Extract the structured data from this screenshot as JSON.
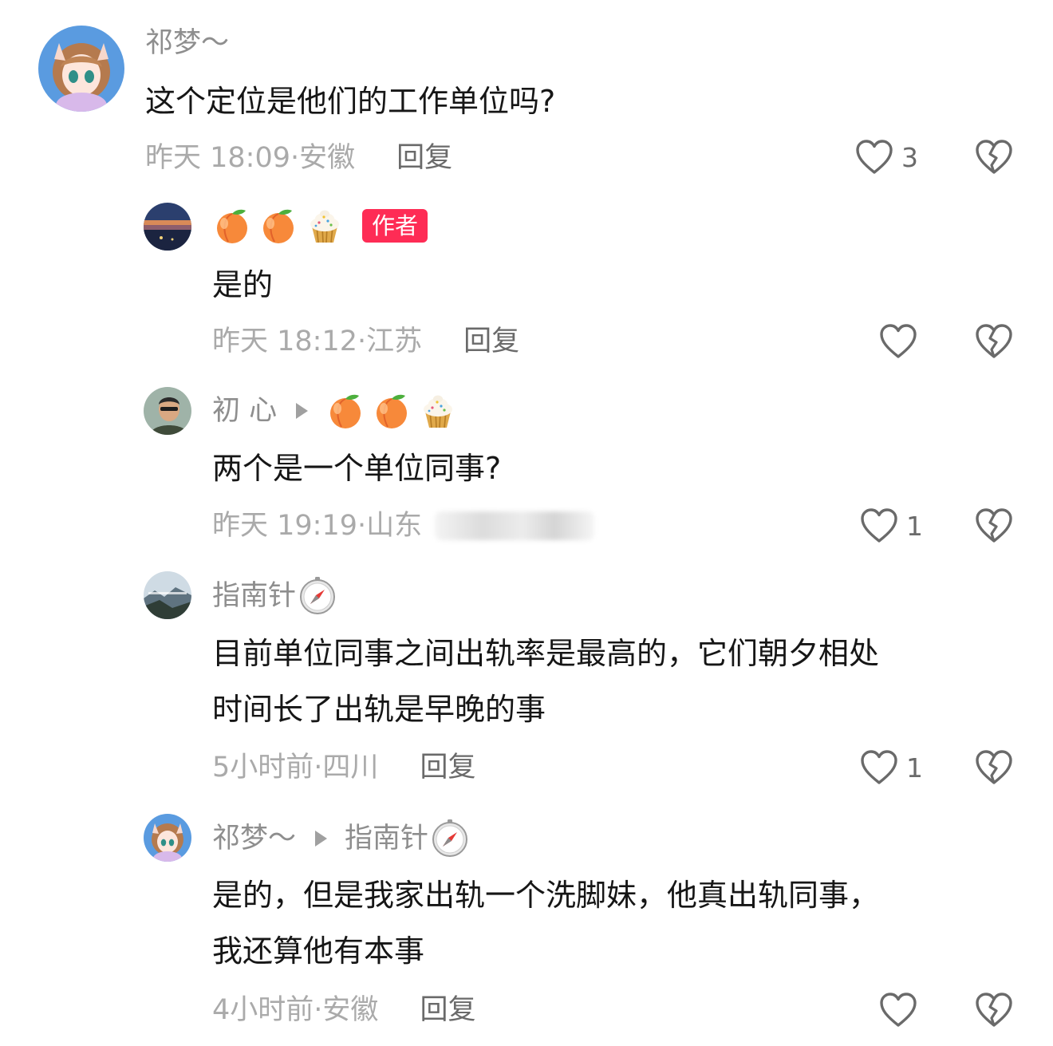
{
  "comments": [
    {
      "user": "祁梦～",
      "text_lines": [
        "这个定位是他们的工作单位吗?"
      ],
      "time": "昨天 18:09",
      "location": "安徽",
      "reply_label": "回复",
      "like_count": "3"
    },
    {
      "user_emojis": [
        "peach-emoji",
        "peach-emoji",
        "cupcake-emoji"
      ],
      "badge": "作者",
      "text_lines": [
        "是的"
      ],
      "time": "昨天 18:12",
      "location": "江苏",
      "reply_label": "回复",
      "like_count": ""
    },
    {
      "user": "初 心",
      "reply_to_emojis": [
        "peach-emoji",
        "peach-emoji",
        "cupcake-emoji"
      ],
      "text_lines": [
        "两个是一个单位同事?"
      ],
      "time": "昨天 19:19",
      "location": "山东",
      "like_count": "1"
    },
    {
      "user": "指南针",
      "user_icon": "compass-icon",
      "text_lines": [
        "目前单位同事之间出轨率是最高的，它们朝夕相处",
        "时间长了出轨是早晚的事"
      ],
      "time": "5小时前",
      "location": "四川",
      "reply_label": "回复",
      "like_count": "1"
    },
    {
      "user": "祁梦～",
      "reply_to": "指南针",
      "reply_to_icon": "compass-icon",
      "text_lines": [
        "是的，但是我家出轨一个洗脚妹，他真出轨同事，",
        "我还算他有本事"
      ],
      "time": "4小时前",
      "location": "安徽",
      "reply_label": "回复",
      "like_count": ""
    }
  ],
  "colors": {
    "author_badge": "#fe2c55",
    "name_gray": "#8e8e8e",
    "meta_gray": "#aaaaaa",
    "text": "#161616"
  },
  "icons": [
    "heart-outline-icon",
    "broken-heart-icon",
    "play-arrow-icon"
  ]
}
